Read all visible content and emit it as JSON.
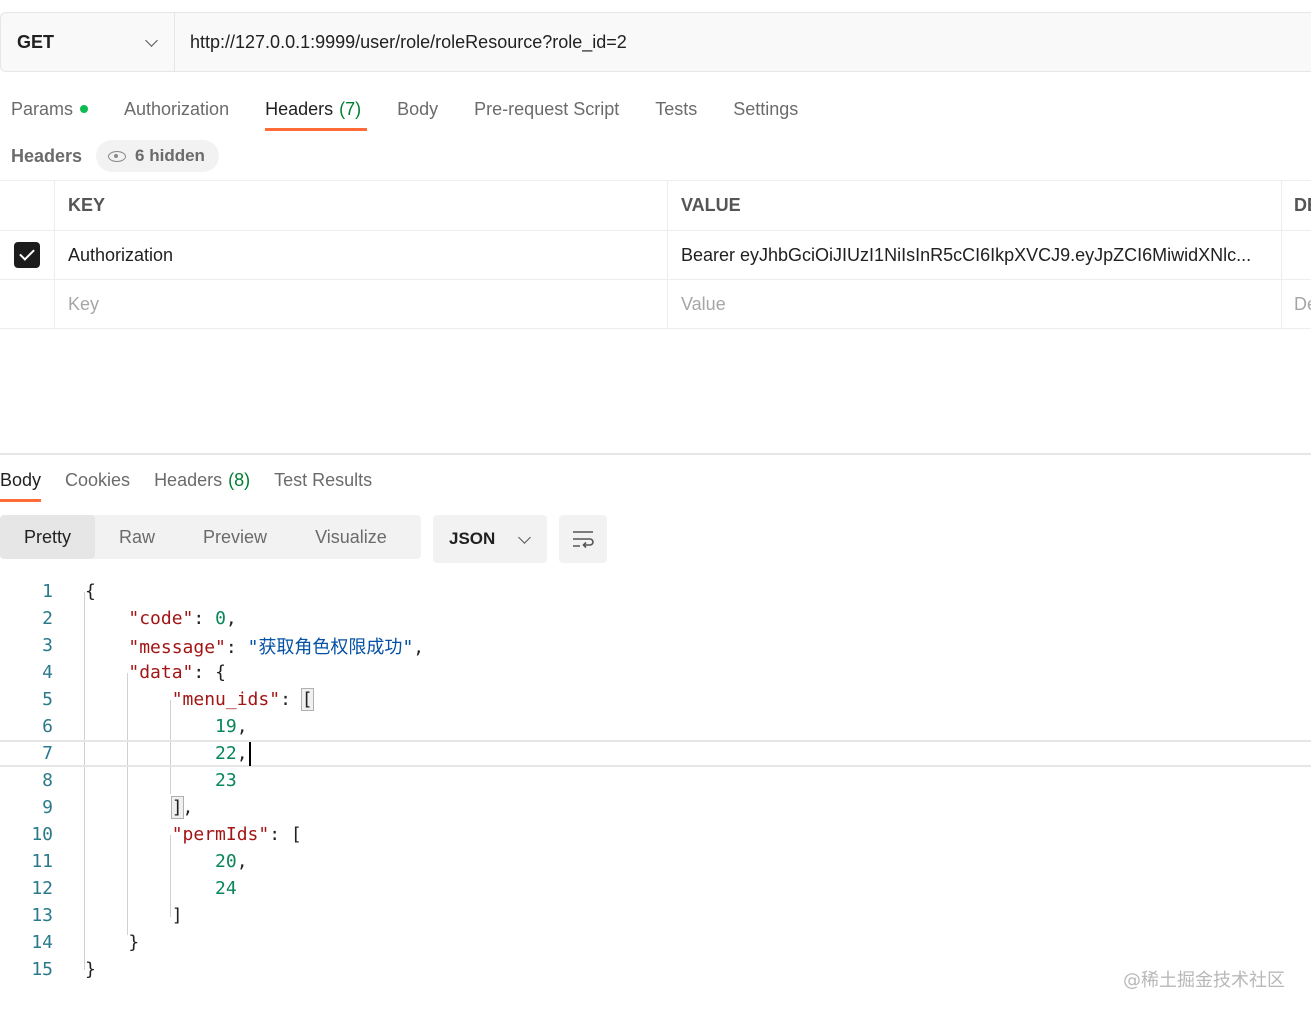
{
  "request": {
    "method": "GET",
    "url": "http://127.0.0.1:9999/user/role/roleResource?role_id=2"
  },
  "request_tabs": [
    {
      "label": "Params",
      "has_dot": true
    },
    {
      "label": "Authorization"
    },
    {
      "label": "Headers",
      "count": "(7)",
      "active": true
    },
    {
      "label": "Body"
    },
    {
      "label": "Pre-request Script"
    },
    {
      "label": "Tests"
    },
    {
      "label": "Settings"
    }
  ],
  "headers_section": {
    "title": "Headers",
    "hidden_label": "6 hidden"
  },
  "headers_table": {
    "columns": {
      "key": "KEY",
      "value": "VALUE",
      "description": "DESCRIPTION"
    },
    "rows": [
      {
        "checked": true,
        "key": "Authorization",
        "value": "Bearer eyJhbGciOiJIUzI1NiIsInR5cCI6IkpXVCJ9.eyJpZCI6MiwidXNlc..."
      }
    ],
    "placeholder": {
      "key": "Key",
      "value": "Value",
      "description": "Description"
    }
  },
  "response_tabs": [
    {
      "label": "Body",
      "active": true
    },
    {
      "label": "Cookies"
    },
    {
      "label": "Headers",
      "count": "(8)"
    },
    {
      "label": "Test Results"
    }
  ],
  "view_modes": [
    {
      "label": "Pretty",
      "active": true
    },
    {
      "label": "Raw"
    },
    {
      "label": "Preview"
    },
    {
      "label": "Visualize"
    }
  ],
  "format": "JSON",
  "response_body": {
    "line_numbers": [
      "1",
      "2",
      "3",
      "4",
      "5",
      "6",
      "7",
      "8",
      "9",
      "10",
      "11",
      "12",
      "13",
      "14",
      "15"
    ],
    "code": 0,
    "message": "获取角色权限成功",
    "menu_ids": [
      19,
      22,
      23
    ],
    "permIds": [
      20,
      24
    ]
  },
  "watermark": "@稀土掘金技术社区"
}
